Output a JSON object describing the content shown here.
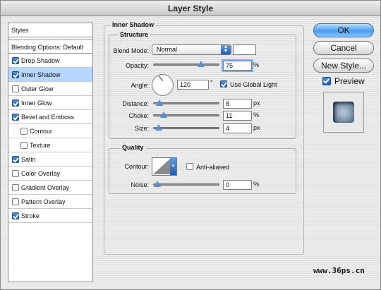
{
  "window": {
    "title": "Layer Style"
  },
  "sidebar": {
    "header": "Styles",
    "blending": "Blending Options: Default",
    "items": [
      {
        "label": "Drop Shadow",
        "checked": true,
        "sub": false,
        "selected": false
      },
      {
        "label": "Inner Shadow",
        "checked": true,
        "sub": false,
        "selected": true
      },
      {
        "label": "Outer Glow",
        "checked": false,
        "sub": false,
        "selected": false
      },
      {
        "label": "Inner Glow",
        "checked": true,
        "sub": false,
        "selected": false
      },
      {
        "label": "Bevel and Emboss",
        "checked": true,
        "sub": false,
        "selected": false
      },
      {
        "label": "Contour",
        "checked": false,
        "sub": true,
        "selected": false
      },
      {
        "label": "Texture",
        "checked": false,
        "sub": true,
        "selected": false
      },
      {
        "label": "Satin",
        "checked": true,
        "sub": false,
        "selected": false
      },
      {
        "label": "Color Overlay",
        "checked": false,
        "sub": false,
        "selected": false
      },
      {
        "label": "Gradient Overlay",
        "checked": false,
        "sub": false,
        "selected": false
      },
      {
        "label": "Pattern Overlay",
        "checked": false,
        "sub": false,
        "selected": false
      },
      {
        "label": "Stroke",
        "checked": true,
        "sub": false,
        "selected": false
      }
    ]
  },
  "panel": {
    "title": "Inner Shadow",
    "structure": {
      "title": "Structure",
      "blend_mode_label": "Blend Mode:",
      "blend_mode_value": "Normal",
      "opacity_label": "Opacity:",
      "opacity_value": "75",
      "opacity_unit": "%",
      "opacity_level": 0.75,
      "angle_label": "Angle:",
      "angle_value": "120",
      "angle_unit": "°",
      "global_light_label": "Use Global Light",
      "global_light_checked": true,
      "distance_label": "Distance:",
      "distance_value": "8",
      "distance_unit": "px",
      "distance_level": 0.04,
      "choke_label": "Choke:",
      "choke_value": "11",
      "choke_unit": "%",
      "choke_level": 0.11,
      "size_label": "Size:",
      "size_value": "4",
      "size_unit": "px",
      "size_level": 0.02
    },
    "quality": {
      "title": "Quality",
      "contour_label": "Contour:",
      "anti_aliased_label": "Anti-aliased",
      "anti_aliased_checked": false,
      "noise_label": "Noise:",
      "noise_value": "0",
      "noise_unit": "%",
      "noise_level": 0.0
    }
  },
  "buttons": {
    "ok": "OK",
    "cancel": "Cancel",
    "new_style": "New Style...",
    "preview_label": "Preview",
    "preview_checked": true
  },
  "watermark": "www.36ps.cn"
}
